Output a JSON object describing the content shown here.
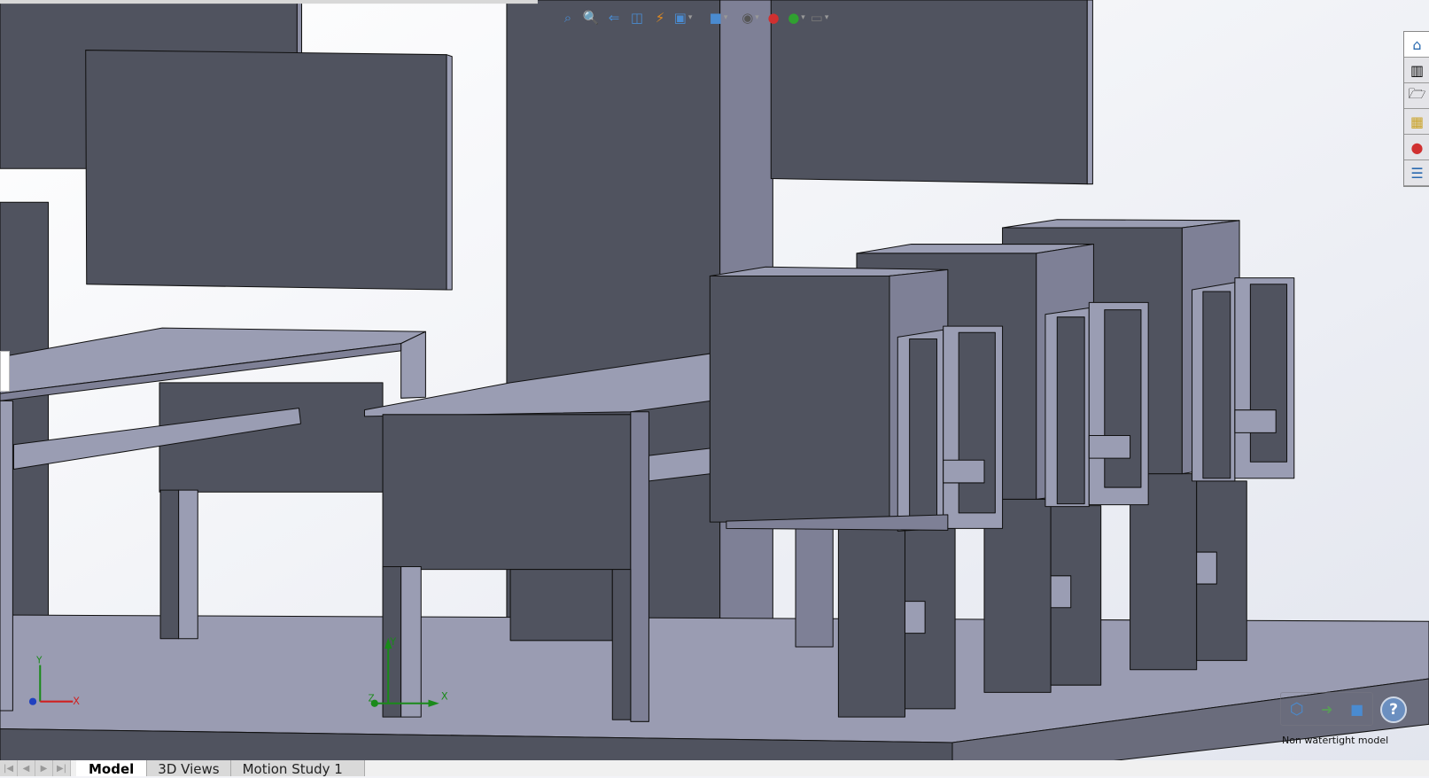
{
  "toolbar": {
    "icons": [
      "zoom-to-fit-icon",
      "zoom-to-area-icon",
      "previous-view-icon",
      "section-view-icon",
      "dynamic-annotation-icon",
      "view-orientation-icon",
      "display-style-icon",
      "hide-show-items-icon",
      "edit-appearance-icon",
      "apply-scene-icon",
      "view-settings-icon"
    ]
  },
  "taskpane": {
    "icons": [
      "home-icon",
      "design-library-icon",
      "file-explorer-icon",
      "view-palette-icon",
      "appearances-icon",
      "custom-properties-icon"
    ]
  },
  "triads": {
    "x": "X",
    "y": "Y",
    "z": "Z"
  },
  "status": {
    "message": "Non watertight model",
    "help": "?"
  },
  "tabs": [
    {
      "label": "Model",
      "active": true
    },
    {
      "label": "3D Views",
      "active": false
    },
    {
      "label": "Motion Study 1",
      "active": false
    }
  ],
  "colors": {
    "dark_face": "#50535f",
    "light_face": "#9a9db3",
    "mid_face": "#7e8096",
    "background": "#f2f3f7"
  }
}
